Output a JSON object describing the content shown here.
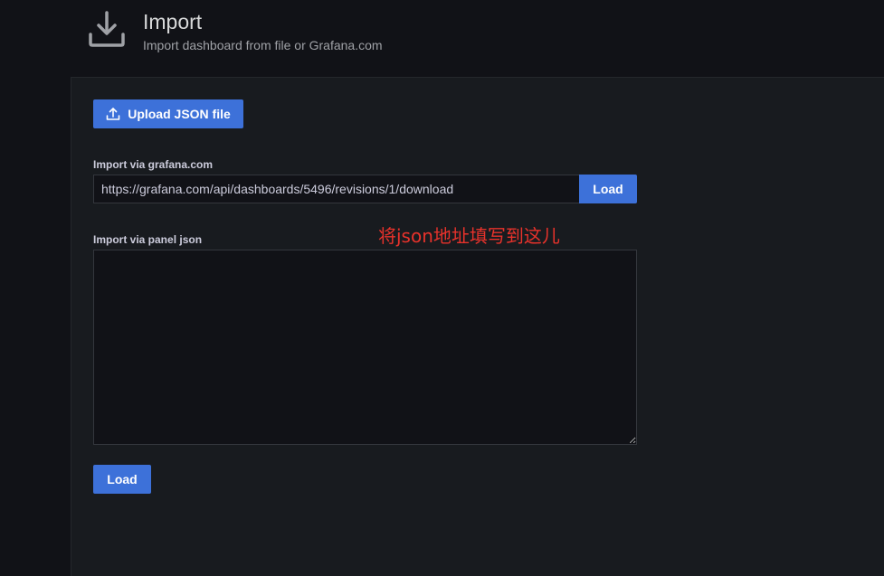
{
  "header": {
    "title": "Import",
    "subtitle": "Import dashboard from file or Grafana.com",
    "icon": "download-icon"
  },
  "upload": {
    "label": "Upload JSON file",
    "icon": "upload-icon"
  },
  "grafana_com": {
    "label": "Import via grafana.com",
    "value": "https://grafana.com/api/dashboards/5496/revisions/1/download",
    "load_label": "Load"
  },
  "panel_json": {
    "label": "Import via panel json",
    "value": ""
  },
  "footer": {
    "load_label": "Load"
  },
  "annotation": {
    "text": "将json地址填写到这儿",
    "color": "#e8322b"
  },
  "colors": {
    "primary": "#3d71d9",
    "background": "#111217",
    "panel": "#181b1f"
  }
}
